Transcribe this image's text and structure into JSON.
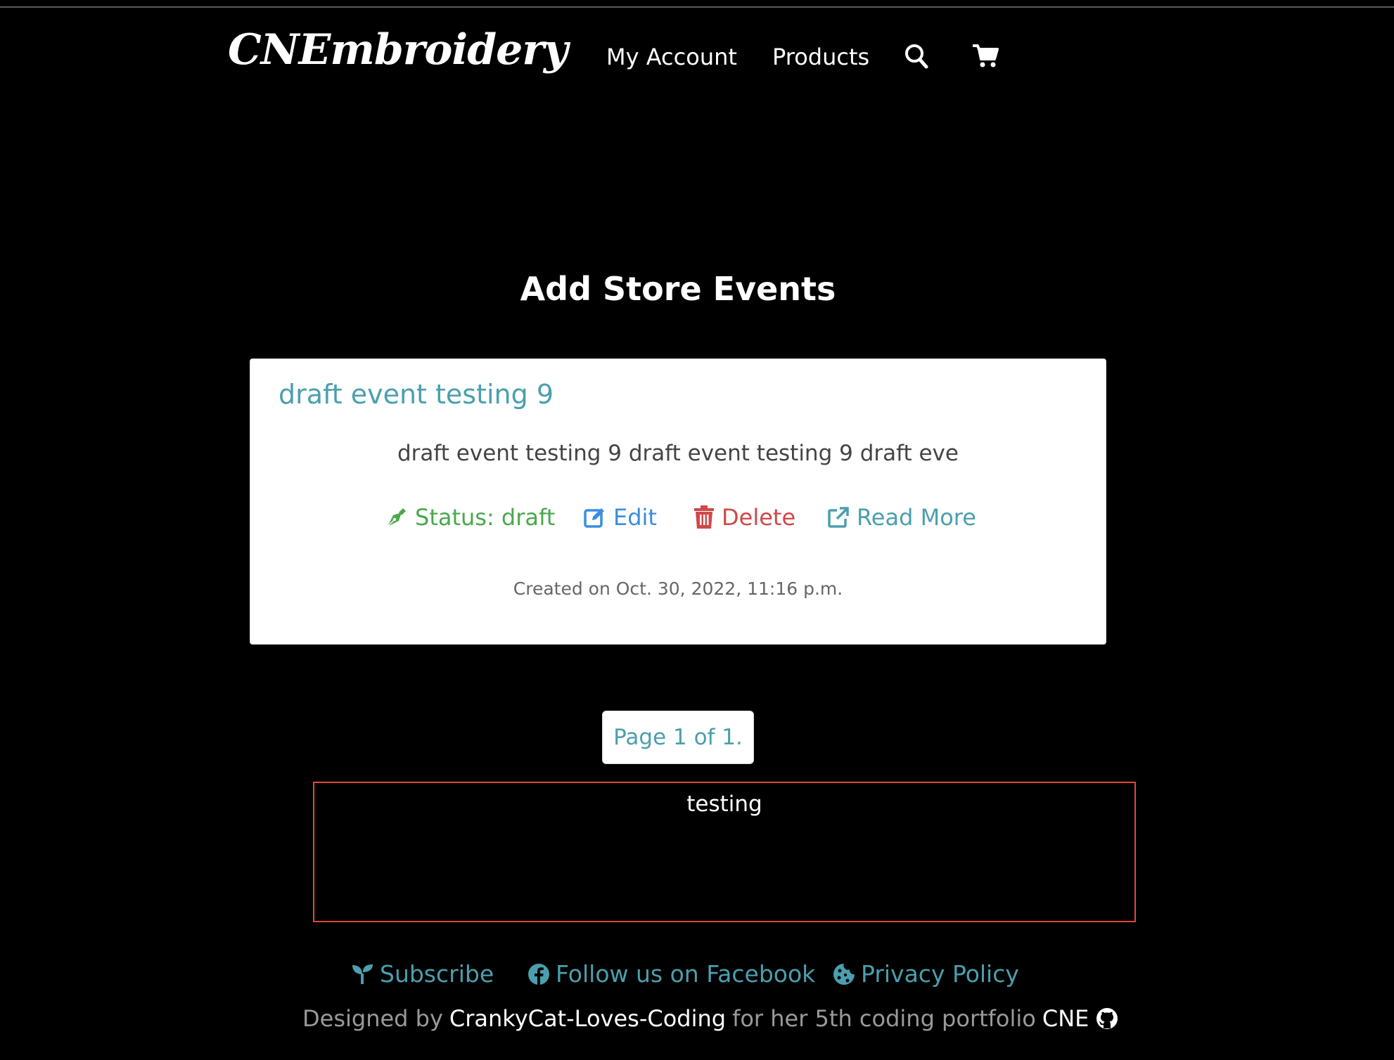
{
  "header": {
    "logo": "CNEmbroidery",
    "nav_account": "My Account",
    "nav_products": "Products",
    "search_icon": "search-icon",
    "cart_icon": "cart-icon"
  },
  "page": {
    "title": "Add Store Events"
  },
  "event_card": {
    "title": "draft event testing 9",
    "excerpt": "draft event testing 9 draft event testing 9 draft eve",
    "status_label": "Status: draft",
    "edit_label": "Edit",
    "delete_label": "Delete",
    "read_more_label": "Read More",
    "created": "Created on Oct. 30, 2022, 11:16 p.m."
  },
  "pagination": {
    "label": "Page 1 of 1."
  },
  "notice": {
    "text": "testing"
  },
  "footer": {
    "subscribe": "Subscribe",
    "facebook": "Follow us on Facebook",
    "privacy": "Privacy Policy",
    "designed_by": "Designed by",
    "author": "CrankyCat-Loves-Coding",
    "for_text": "for her 5th coding portfolio",
    "project": "CNE"
  },
  "colors": {
    "background": "#000000",
    "link_teal": "#4b9fae",
    "status_green": "#4aa84c",
    "edit_blue": "#3a8de0",
    "delete_red": "#d04848",
    "alert_border": "#e0483a"
  }
}
